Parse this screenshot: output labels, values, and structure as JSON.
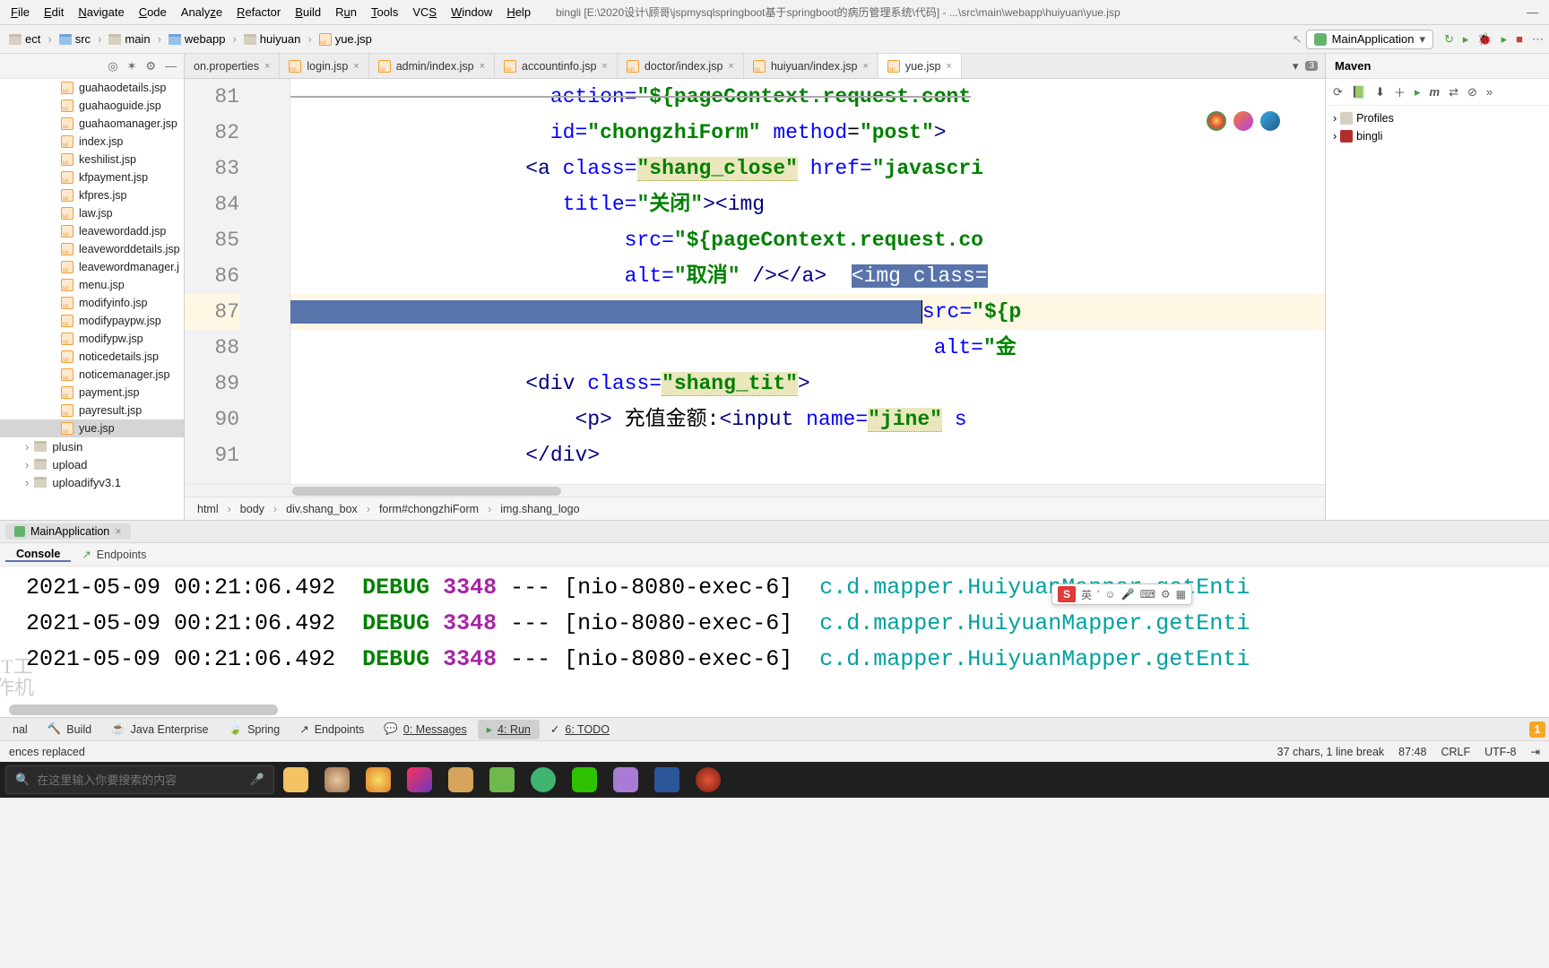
{
  "menu": {
    "file": "File",
    "edit": "Edit",
    "navigate": "Navigate",
    "code": "Code",
    "analyze": "Analyze",
    "refactor": "Refactor",
    "build": "Build",
    "run": "Run",
    "tools": "Tools",
    "vcs": "VCS",
    "window": "Window",
    "help": "Help"
  },
  "title": "bingli [E:\\2020设计\\顾哥\\jspmysqlspringboot基于springboot的病历管理系统\\代码] - ...\\src\\main\\webapp\\huiyuan\\yue.jsp",
  "navbar": {
    "proj_suffix": "ect",
    "src": "src",
    "main": "main",
    "webapp": "webapp",
    "huiyuan": "huiyuan",
    "file": "yue.jsp"
  },
  "runcfg": {
    "name": "MainApplication"
  },
  "tree": {
    "files": [
      "guahaodetails.jsp",
      "guahaoguide.jsp",
      "guahaomanager.jsp",
      "index.jsp",
      "keshilist.jsp",
      "kfpayment.jsp",
      "kfpres.jsp",
      "law.jsp",
      "leavewordadd.jsp",
      "leaveworddetails.jsp",
      "leavewordmanager.j",
      "menu.jsp",
      "modifyinfo.jsp",
      "modifypaypw.jsp",
      "modifypw.jsp",
      "noticedetails.jsp",
      "noticemanager.jsp",
      "payment.jsp",
      "payresult.jsp",
      "yue.jsp"
    ],
    "dirs": [
      "plusin",
      "upload",
      "uploadifyv3.1"
    ]
  },
  "tabs": [
    "on.properties",
    "login.jsp",
    "admin/index.jsp",
    "accountinfo.jsp",
    "doctor/index.jsp",
    "huiyuan/index.jsp",
    "yue.jsp"
  ],
  "active_tab": 6,
  "tabs_extra": "3",
  "code": {
    "lines": {
      "l80": {
        "a": "action=",
        "b": "\"${pageContext.request.cont"
      },
      "l82": {
        "a": "id=",
        "b": "\"chongzhiForm\"",
        "c": " method",
        "d": "=",
        "e": "\"post\"",
        "f": ">"
      },
      "l83": {
        "a": "<a ",
        "b": "class=",
        "c": "\"shang_close\"",
        "d": " href=",
        "e": "\"javascri"
      },
      "l84": {
        "a": "title=",
        "b": "\"关闭\"",
        "c": "><img"
      },
      "l85": {
        "a": "src=",
        "b": "\"${pageContext.request.co"
      },
      "l86": {
        "a": "alt=",
        "b": "\"取消\"",
        "c": " /></a>  ",
        "d": "<img ",
        "e": "class="
      },
      "l87": {
        "a": "src=",
        "b": "\"${p"
      },
      "l88": {
        "a": "alt=",
        "b": "\"金"
      },
      "l89": {
        "a": "<div ",
        "b": "class=",
        "c": "\"shang_tit\"",
        "d": ">"
      },
      "l90": {
        "a": "<p>",
        "b": " 充值金额:",
        "c": "<input ",
        "d": "name=",
        "e": "\"jine\"",
        "f": " s"
      },
      "l91": {
        "a": "</div>"
      }
    },
    "gutter": [
      "81",
      "82",
      "83",
      "84",
      "85",
      "86",
      "87",
      "88",
      "89",
      "90",
      "91"
    ]
  },
  "breadcrumb2": [
    "html",
    "body",
    "div.shang_box",
    "form#chongzhiForm",
    "img.shang_logo"
  ],
  "maven": {
    "title": "Maven",
    "profiles": "Profiles",
    "proj": "bingli"
  },
  "runtool": {
    "app": "MainApplication",
    "console": "Console",
    "endpoints": "Endpoints"
  },
  "log": {
    "rows": [
      {
        "ts": "2021-05-09 00:21:06.492",
        "lvl": "DEBUG",
        "tid": "3348",
        "thr": "[nio-8080-exec-6]",
        "cls": "c.d.mapper.HuiyuanMapper.getEnti"
      },
      {
        "ts": "2021-05-09 00:21:06.492",
        "lvl": "DEBUG",
        "tid": "3348",
        "thr": "[nio-8080-exec-6]",
        "cls": "c.d.mapper.HuiyuanMapper.getEnti"
      },
      {
        "ts": "2021-05-09 00:21:06.492",
        "lvl": "DEBUG",
        "tid": "3348",
        "thr": "[nio-8080-exec-6]",
        "cls": "c.d.mapper.HuiyuanMapper.getEnti"
      }
    ]
  },
  "bottombar": {
    "terminal": "nal",
    "build": "Build",
    "jee": "Java Enterprise",
    "spring": "Spring",
    "endpoints": "Endpoints",
    "messages": "0: Messages",
    "run": "4: Run",
    "todo": "6: TODO",
    "badge": "1"
  },
  "statusbar": {
    "left": "ences replaced",
    "sel": "37 chars, 1 line break",
    "pos": "87:48",
    "crlf": "CRLF",
    "enc": "UTF-8"
  },
  "taskbar": {
    "search_ph": "在这里输入你要搜索的内容"
  },
  "ime": {
    "logo": "S",
    "lang": "英",
    "s2": "'",
    "e": "☺",
    "mic": "🎤",
    "kb": "⌨",
    "gear": "⚙",
    "grid": "▦"
  }
}
